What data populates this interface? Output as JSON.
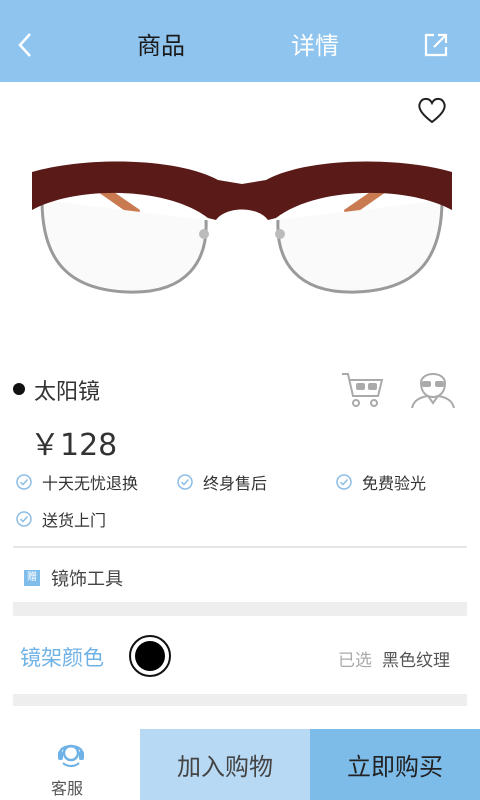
{
  "header": {
    "tab_product": "商品",
    "tab_detail": "详情",
    "back_icon": "back-arrow-icon",
    "share_icon": "share-icon",
    "bg_color": "#8fc4ee"
  },
  "product": {
    "title": "太阳镜",
    "price": "￥128",
    "favorite_icon": "heart-icon",
    "features": [
      "十天无忧退换",
      "终身售后",
      "免费验光",
      "送货上门"
    ]
  },
  "tools": {
    "badge": "赠",
    "label": "镜饰工具"
  },
  "frame_color": {
    "label": "镜架颜色",
    "selected_prefix": "已选",
    "selected_value": "黑色纹理"
  },
  "bottom_bar": {
    "service_label": "客服",
    "add_to_cart": "加入购物",
    "buy_now": "立即购买",
    "accent_color": "#7dbbe9"
  }
}
